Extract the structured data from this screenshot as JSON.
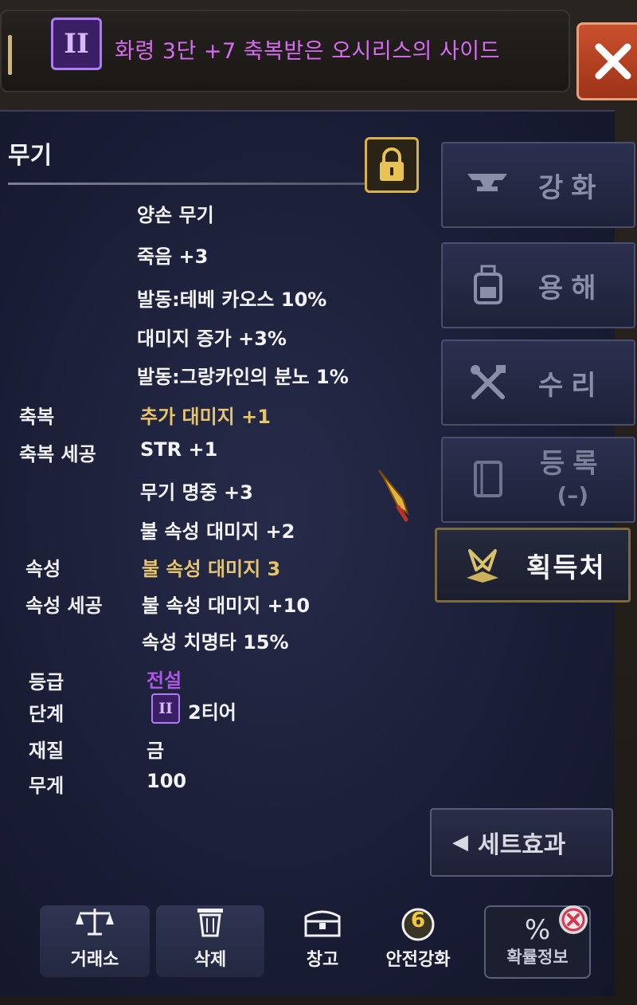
{
  "header": {
    "tier_badge": "II",
    "item_name": "화령 3단 +7 축복받은 오시리스의 사이드",
    "close_label": "X"
  },
  "section": {
    "title": "무기"
  },
  "stats": {
    "type": "양손 무기",
    "base": [
      "죽음 +3",
      "발동:테베 카오스 10%",
      "대미지 증가 +3%",
      "발동:그랑카인의 분노 1%"
    ],
    "blessing_label": "축복",
    "blessing": "추가 대미지 +1",
    "blessing_craft_label": "축복 세공",
    "blessing_craft": [
      "STR +1",
      "무기 명중 +3",
      "불 속성 대미지 +2"
    ],
    "attribute_label": "속성",
    "attribute": "불 속성 대미지  3",
    "attribute_craft_label": "속성 세공",
    "attribute_craft": [
      "불 속성 대미지 +10",
      "속성 치명타 15%"
    ],
    "grade_label": "등급",
    "grade": "전설",
    "tier_label": "단계",
    "tier_badge": "II",
    "tier": "2티어",
    "material_label": "재질",
    "material": "금",
    "weight_label": "무게",
    "weight": "100"
  },
  "side_buttons": {
    "enhance": "강화",
    "dissolve": "용해",
    "repair": "수리",
    "register": "등록",
    "register_sub": "(–)",
    "source": "획득처"
  },
  "set_effect": "세트효과",
  "bottom": {
    "exchange": "거래소",
    "delete": "삭제",
    "storage": "창고",
    "safe_enhance_count": "6",
    "safe_enhance": "안전강화",
    "prob_symbol": "%",
    "prob_info": "확률정보"
  },
  "colors": {
    "item_name": "#d66cf0",
    "gold_stat": "#e7c36a",
    "legend_grade": "#b055e8",
    "close": "#c9502e"
  }
}
